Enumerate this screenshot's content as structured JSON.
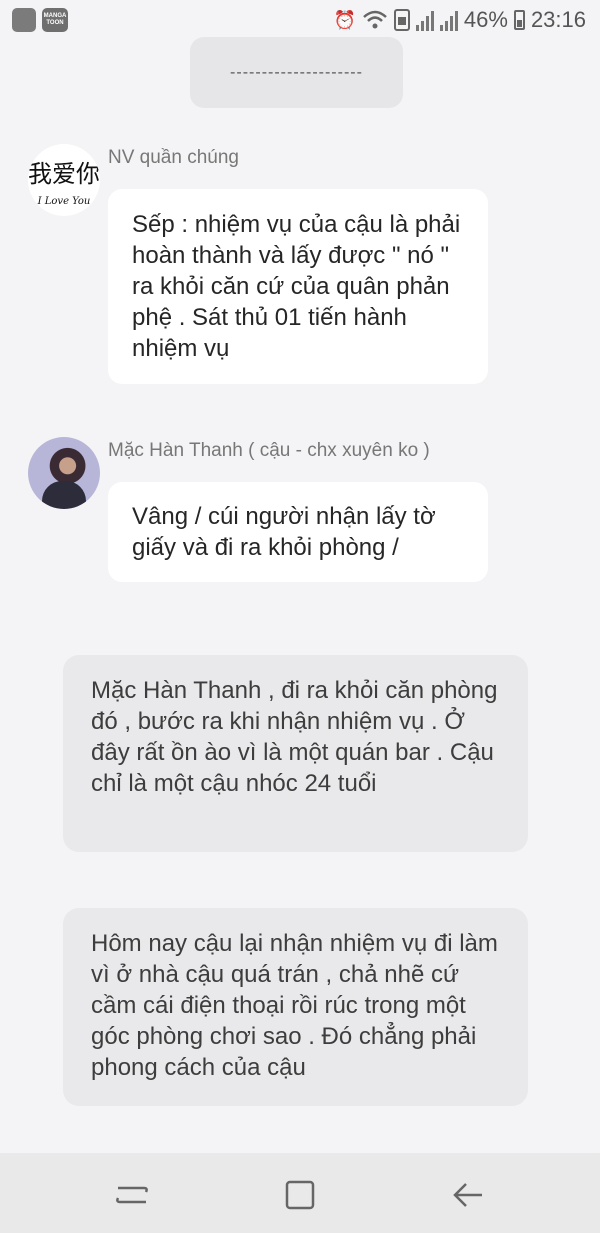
{
  "status_bar": {
    "app_icon_1": "gallery-square-icon",
    "app_logo_text": "MANGA TOON",
    "alarm_icon": "alarm-icon",
    "wifi_icon": "wifi-icon",
    "battery_percent": "46%",
    "time": "23:16"
  },
  "divider": "---------------------",
  "messages": [
    {
      "sender": "NV quần chúng",
      "avatar_text": "我爱你",
      "avatar_subtext": "I Love You",
      "text": "Sếp : nhiệm vụ của cậu là phải hoàn thành và lấy được \" nó \" ra khỏi căn cứ của quân phản phệ . Sát thủ 01 tiến hành nhiệm vụ"
    },
    {
      "sender": "Mặc Hàn Thanh ( cậu - chx xuyên ko )",
      "text": "Vâng / cúi người nhận lấy tờ giấy và đi ra khỏi phòng /"
    }
  ],
  "narrations": [
    "Mặc Hàn Thanh , đi ra khỏi căn phòng đó , bước ra khi nhận nhiệm vụ . Ở đây rất ồn ào vì là một quán bar . Cậu chỉ là một cậu nhóc 24 tuổi",
    "Hôm nay cậu lại nhận nhiệm vụ đi làm vì ở nhà cậu quá trán , chả nhẽ cứ cầm cái điện thoại rồi rúc trong một góc phòng chơi sao . Đó chẳng phải phong cách của cậu"
  ],
  "nav": {
    "recent_icon": "recent-apps-icon",
    "home_icon": "home-icon",
    "back_icon": "back-icon"
  }
}
